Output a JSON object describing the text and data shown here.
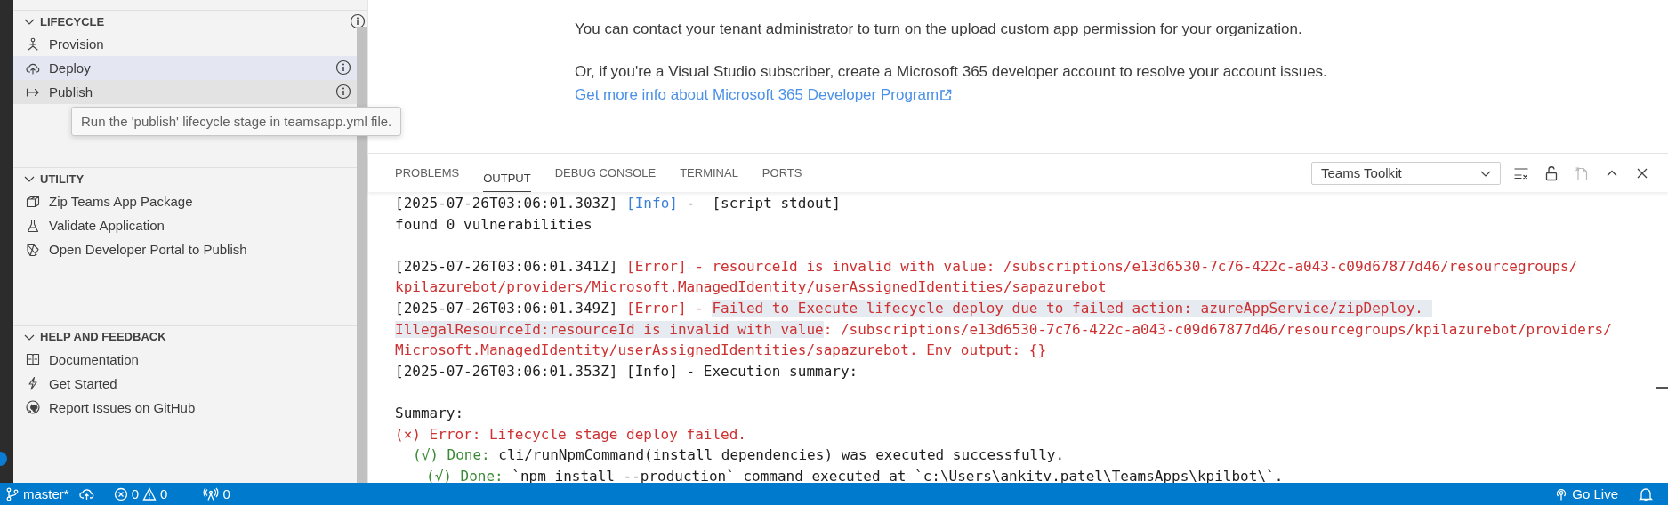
{
  "sidebar": {
    "sections": [
      {
        "title": "LIFECYCLE",
        "expanded": true,
        "info_button": true,
        "items": [
          {
            "label": "Provision",
            "selected": false,
            "hovered": false,
            "info_button": false
          },
          {
            "label": "Deploy",
            "selected": true,
            "hovered": false,
            "info_button": true
          },
          {
            "label": "Publish",
            "selected": false,
            "hovered": true,
            "info_button": true
          }
        ]
      },
      {
        "title": "UTILITY",
        "expanded": true,
        "info_button": false,
        "items": [
          {
            "label": "Zip Teams App Package",
            "selected": false,
            "hovered": false,
            "info_button": false
          },
          {
            "label": "Validate Application",
            "selected": false,
            "hovered": false,
            "info_button": false
          },
          {
            "label": "Open Developer Portal to Publish",
            "selected": false,
            "hovered": false,
            "info_button": false
          }
        ]
      },
      {
        "title": "HELP AND FEEDBACK",
        "expanded": true,
        "info_button": false,
        "items": [
          {
            "label": "Documentation",
            "selected": false,
            "hovered": false,
            "info_button": false
          },
          {
            "label": "Get Started",
            "selected": false,
            "hovered": false,
            "info_button": false
          },
          {
            "label": "Report Issues on GitHub",
            "selected": false,
            "hovered": false,
            "info_button": false
          }
        ]
      }
    ]
  },
  "tooltip": {
    "text": "Run the 'publish' lifecycle stage in teamsapp.yml file."
  },
  "editor": {
    "paragraphs": [
      "You can contact your tenant administrator to turn on the upload custom app permission for your organization.",
      "Or, if you're a Visual Studio subscriber, create a Microsoft 365 developer account to resolve your account issues."
    ],
    "link": "Get more info about Microsoft 365 Developer Program"
  },
  "panel": {
    "tabs": [
      {
        "label": "PROBLEMS",
        "selected": false
      },
      {
        "label": "OUTPUT",
        "selected": true
      },
      {
        "label": "DEBUG CONSOLE",
        "selected": false
      },
      {
        "label": "TERMINAL",
        "selected": false
      },
      {
        "label": "PORTS",
        "selected": false
      }
    ],
    "channel": {
      "value": "Teams Toolkit"
    },
    "output": [
      {
        "lines": [
          {
            "segments": [
              {
                "text": "[2025-07-26T03:06:01.303Z] ",
                "kind": "plain"
              },
              {
                "text": "[Info]",
                "kind": "info"
              },
              {
                "text": " -  [script stdout]",
                "kind": "plain"
              }
            ]
          },
          {
            "segments": [
              {
                "text": "found 0 vulnerabilities",
                "kind": "plain"
              }
            ]
          }
        ]
      },
      {
        "lines": [
          {
            "segments": [
              {
                "text": "[2025-07-26T03:06:01.341Z] ",
                "kind": "plain"
              },
              {
                "text": "[Error] - resourceId is invalid with value: /subscriptions/e13d6530-7c76-422c-a043-c09d67877d46/resourcegroups/",
                "kind": "error"
              }
            ]
          },
          {
            "segments": [
              {
                "text": "kpilazurebot/providers/Microsoft.ManagedIdentity/userAssignedIdentities/sapazurebot",
                "kind": "error"
              }
            ]
          },
          {
            "segments": [
              {
                "text": "[2025-07-26T03:06:01.349Z] ",
                "kind": "plain"
              },
              {
                "text": "[Error] - ",
                "kind": "error"
              },
              {
                "text": "Failed to Execute lifecycle deploy due to failed action: azureAppService/zipDeploy. ",
                "kind": "error",
                "highlighted": true
              }
            ]
          },
          {
            "segments": [
              {
                "text": "IllegalResourceId:resourceId is invalid with value",
                "kind": "error",
                "highlighted": true
              },
              {
                "text": ": /subscriptions/e13d6530-7c76-422c-a043-c09d67877d46/resourcegroups/kpilazurebot/providers/",
                "kind": "error"
              }
            ]
          },
          {
            "segments": [
              {
                "text": "Microsoft.ManagedIdentity/userAssignedIdentities/sapazurebot. Env output: {}",
                "kind": "error"
              }
            ]
          },
          {
            "segments": [
              {
                "text": "[2025-07-26T03:06:01.353Z] [Info] - Execution summary:",
                "kind": "plain"
              }
            ]
          }
        ]
      },
      {
        "lines": [
          {
            "segments": [
              {
                "text": "Summary:",
                "kind": "plain"
              }
            ]
          },
          {
            "segments": [
              {
                "text": "(×) Error: Lifecycle stage deploy failed.",
                "kind": "error"
              }
            ],
            "children": [
              {
                "segments": [
                  {
                    "text": "(√) Done: ",
                    "kind": "done"
                  },
                  {
                    "text": "cli/runNpmCommand(install dependencies) was executed successfully.",
                    "kind": "plain"
                  }
                ],
                "children": [
                  {
                    "segments": [
                      {
                        "text": "(√) Done: ",
                        "kind": "done"
                      },
                      {
                        "text": "`npm install --production` command executed at `c:\\Users\\ankitv.patel\\TeamsApps\\kpilbot\\`.",
                        "kind": "plain"
                      }
                    ]
                  }
                ]
              }
            ]
          }
        ]
      }
    ]
  },
  "status_bar": {
    "branch": "master*",
    "errors": "0",
    "warnings": "0",
    "ports": "0",
    "go_live": "Go Live"
  }
}
